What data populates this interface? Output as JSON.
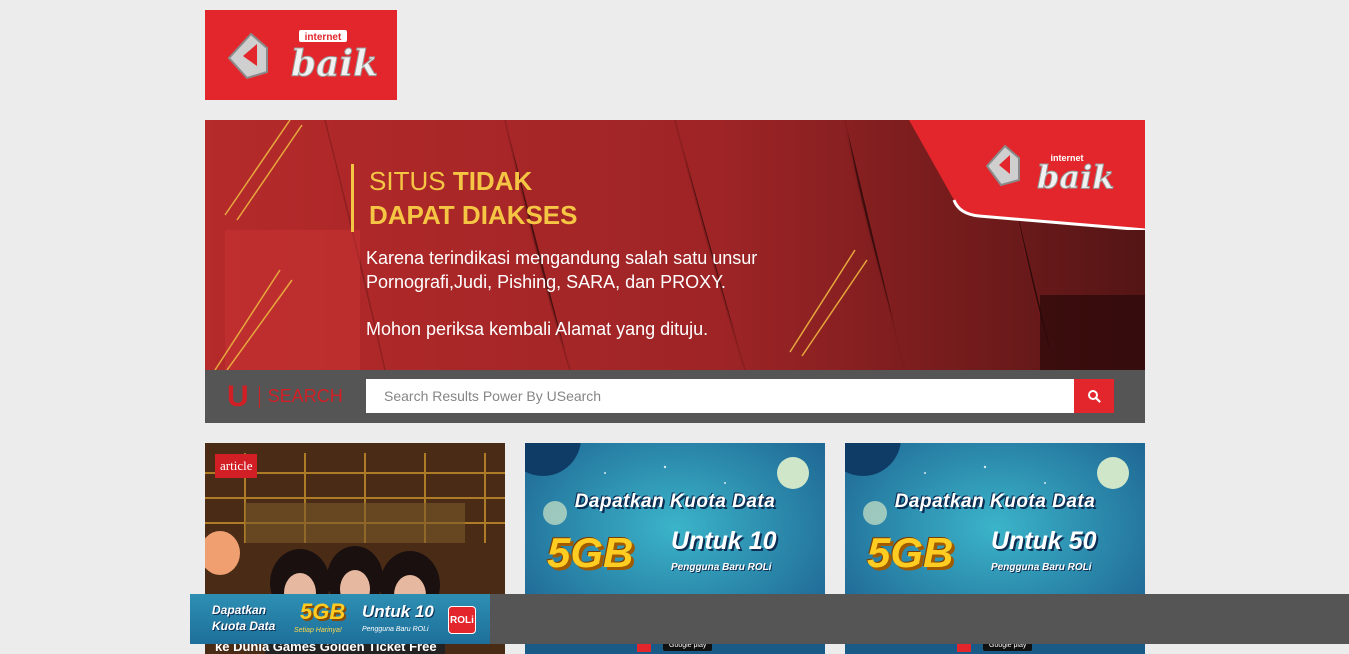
{
  "logo": {
    "text_small": "internet",
    "text_large": "baik"
  },
  "banner": {
    "headline_normal": "SITUS",
    "headline_bold_1": "TIDAK",
    "headline_bold_2": "DAPAT DIAKSES",
    "description": "Karena terindikasi mengandung salah satu unsur Pornografi,Judi, Pishing, SARA, dan PROXY.",
    "instruction": "Mohon periksa kembali Alamat yang dituju."
  },
  "search": {
    "brand_u": "U",
    "brand_label": "SEARCH",
    "placeholder": "Search Results Power By USearch"
  },
  "cards": [
    {
      "badge": "article",
      "caption": "ke Dunia Games Golden Ticket Free"
    },
    {
      "title": "Dapatkan Kuota Data",
      "gb": "5GB",
      "untuk": "Untuk 10",
      "sub": "Pengguna Baru ROLi",
      "store": "Google play"
    },
    {
      "title": "Dapatkan Kuota Data",
      "gb": "5GB",
      "untuk": "Untuk 50",
      "sub": "Pengguna Baru ROLi",
      "store": "Google play"
    }
  ],
  "bottom_ad": {
    "line1": "Dapatkan",
    "line2": "Kuota Data",
    "gb": "5GB",
    "gb_sub": "Setiap Harinya!",
    "untuk": "Untuk 10",
    "sub": "Pengguna Baru ROLi",
    "app": "ROLi"
  },
  "colors": {
    "brand_red": "#e3262b",
    "accent_yellow": "#f5c644",
    "bar_gray": "#555555",
    "page_bg": "#ececec"
  }
}
